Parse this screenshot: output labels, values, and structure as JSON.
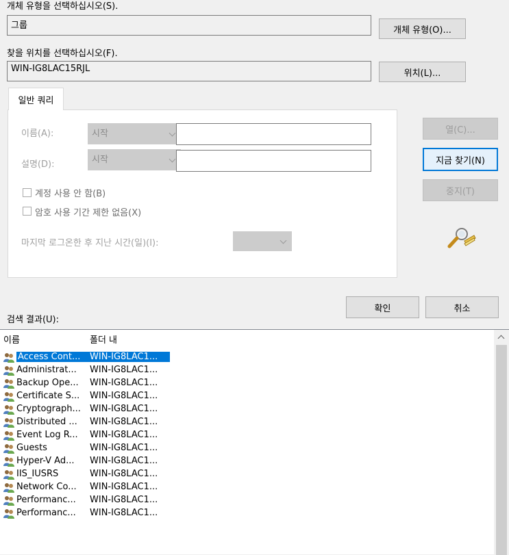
{
  "object_type": {
    "label": "개체 유형을 선택하십시오(S).",
    "value": "그룹",
    "button": "개체 유형(O)..."
  },
  "location": {
    "label": "찾을 위치를 선택하십시오(F).",
    "value": "WIN-IG8LAC15RJL",
    "button": "위치(L)..."
  },
  "tab": {
    "label": "일반 쿼리"
  },
  "query": {
    "name_label": "이름(A):",
    "name_mode": "시작",
    "desc_label": "설명(D):",
    "desc_mode": "시작",
    "disabled_accounts": "계정 사용 안 함(B)",
    "non_expiring": "암호 사용 기간 제한 없음(X)",
    "days_label": "마지막 로그온한 후 지난 시간(일)(I):",
    "days_value": ""
  },
  "buttons": {
    "columns": "열(C)...",
    "find_now": "지금 찾기(N)",
    "stop": "중지(T)",
    "ok": "확인",
    "cancel": "취소"
  },
  "icons": {
    "search": "search-magnifier-icon",
    "group": "group-icon",
    "scroll_up": "chevron-up-icon"
  },
  "results": {
    "label": "검색 결과(U):",
    "columns": [
      "이름",
      "폴더 내"
    ],
    "rows": [
      {
        "name": "Access Cont...",
        "folder": "WIN-IG8LAC1..."
      },
      {
        "name": "Administrat...",
        "folder": "WIN-IG8LAC1..."
      },
      {
        "name": "Backup Ope...",
        "folder": "WIN-IG8LAC1..."
      },
      {
        "name": "Certificate S...",
        "folder": "WIN-IG8LAC1..."
      },
      {
        "name": "Cryptograph...",
        "folder": "WIN-IG8LAC1..."
      },
      {
        "name": "Distributed ...",
        "folder": "WIN-IG8LAC1..."
      },
      {
        "name": "Event Log R...",
        "folder": "WIN-IG8LAC1..."
      },
      {
        "name": "Guests",
        "folder": "WIN-IG8LAC1..."
      },
      {
        "name": "Hyper-V Ad...",
        "folder": "WIN-IG8LAC1..."
      },
      {
        "name": "IIS_IUSRS",
        "folder": "WIN-IG8LAC1..."
      },
      {
        "name": "Network Co...",
        "folder": "WIN-IG8LAC1..."
      },
      {
        "name": "Performanc...",
        "folder": "WIN-IG8LAC1..."
      },
      {
        "name": "Performanc...",
        "folder": "WIN-IG8LAC1..."
      }
    ]
  },
  "colors": {
    "selection": "#0078d7",
    "focus_border": "#0078d7"
  }
}
